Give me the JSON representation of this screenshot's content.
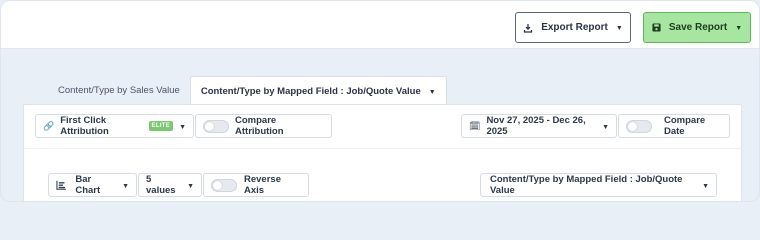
{
  "header": {
    "export_label": "Export Report",
    "save_label": "Save Report"
  },
  "tabs": [
    {
      "label": "Content/Type by Sales Value",
      "active": false
    },
    {
      "label": "Content/Type by Mapped Field : Job/Quote Value",
      "active": true
    }
  ],
  "filters": {
    "attribution_label": "First Click Attribution",
    "attribution_badge": "ELITE",
    "compare_attribution_label": "Compare Attribution",
    "date_range": "Nov 27, 2025 - Dec 26, 2025",
    "compare_date_label": "Compare Date"
  },
  "chart_controls": {
    "chart_type": "Bar Chart",
    "values_count": "5 values",
    "reverse_axis_label": "Reverse Axis",
    "field_select": "Content/Type by Mapped Field : Job/Quote Value"
  },
  "colors": {
    "save_bg": "#a6e6a0",
    "badge_bg": "#7bc96f"
  },
  "icons": {
    "export": "download-icon",
    "save": "floppy-icon",
    "link": "link-icon",
    "calendar": "calendar-icon",
    "chart": "bar-chart-icon"
  }
}
